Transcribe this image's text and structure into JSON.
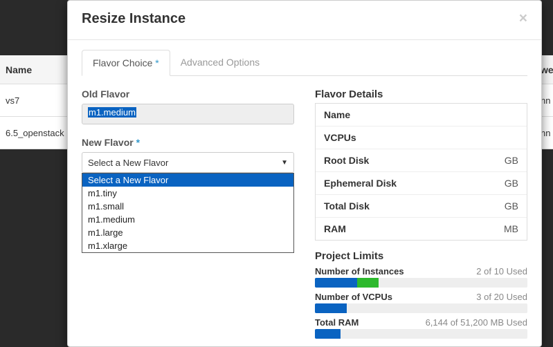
{
  "background": {
    "header_name": "Name",
    "rows": [
      "vs7",
      "6.5_openstack"
    ],
    "right_header": "we",
    "right_cells": [
      "nn",
      "nn"
    ]
  },
  "modal": {
    "title": "Resize Instance",
    "close": "×",
    "tabs": {
      "flavor": "Flavor Choice",
      "advanced": "Advanced Options"
    },
    "old_flavor_label": "Old Flavor",
    "old_flavor_value": "m1.medium",
    "new_flavor_label": "New Flavor",
    "new_flavor_selected": "Select a New Flavor",
    "options": [
      "Select a New Flavor",
      "m1.tiny",
      "m1.small",
      "m1.medium",
      "m1.large",
      "m1.xlarge"
    ],
    "details": {
      "heading": "Flavor Details",
      "rows": [
        {
          "k": "Name",
          "v": ""
        },
        {
          "k": "VCPUs",
          "v": ""
        },
        {
          "k": "Root Disk",
          "v": "GB"
        },
        {
          "k": "Ephemeral Disk",
          "v": "GB"
        },
        {
          "k": "Total Disk",
          "v": "GB"
        },
        {
          "k": "RAM",
          "v": "MB"
        }
      ]
    },
    "limits": {
      "heading": "Project Limits",
      "items": [
        {
          "label": "Number of Instances",
          "used_text": "2 of 10 Used",
          "used_pct": 20,
          "add_pct": 10
        },
        {
          "label": "Number of VCPUs",
          "used_text": "3 of 20 Used",
          "used_pct": 15,
          "add_pct": 0
        },
        {
          "label": "Total RAM",
          "used_text": "6,144 of 51,200 MB Used",
          "used_pct": 12,
          "add_pct": 0
        }
      ]
    }
  }
}
